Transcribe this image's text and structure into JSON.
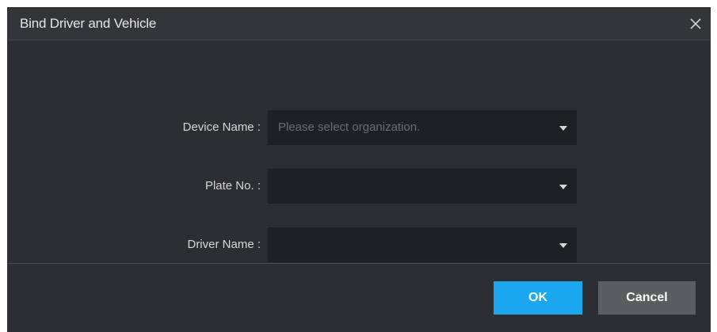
{
  "dialog": {
    "title": "Bind Driver and Vehicle",
    "close_icon": "close-icon"
  },
  "form": {
    "device_name": {
      "label": "Device Name :",
      "value": "",
      "placeholder": "Please select organization."
    },
    "plate_no": {
      "label": "Plate No. :",
      "value": ""
    },
    "driver_name": {
      "label": "Driver Name :",
      "value": ""
    }
  },
  "buttons": {
    "ok_label": "OK",
    "cancel_label": "Cancel"
  },
  "colors": {
    "accent": "#1ba8f0",
    "dialog_bg": "#2d2e32",
    "field_bg": "#1f2023",
    "cancel_bg": "#5c5d61"
  }
}
